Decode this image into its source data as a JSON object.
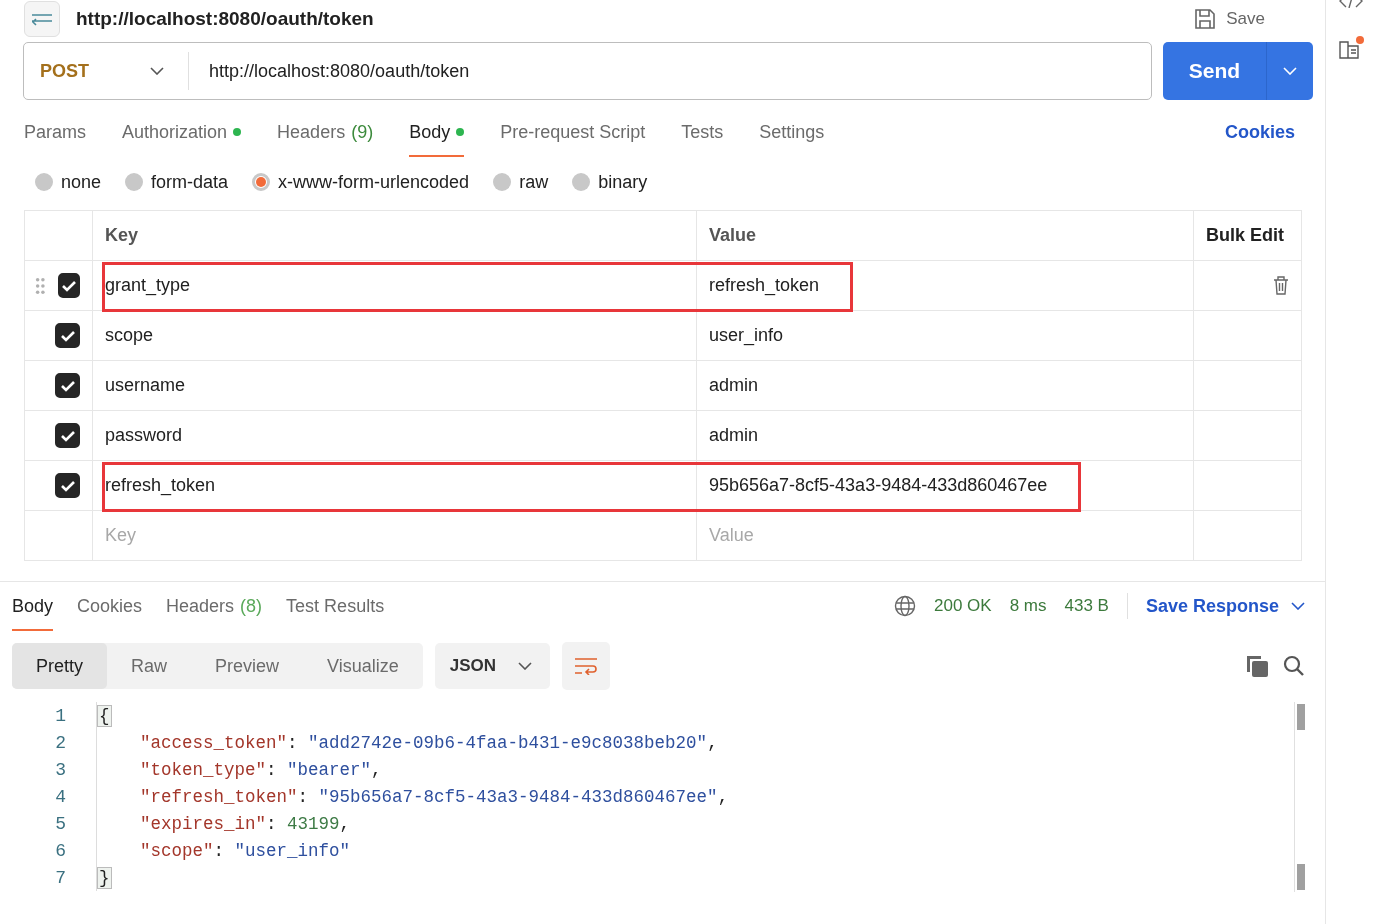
{
  "top": {
    "title": "http://localhost:8080/oauth/token",
    "save": "Save"
  },
  "request": {
    "method": "POST",
    "url": "http://localhost:8080/oauth/token",
    "send": "Send"
  },
  "request_tabs": [
    {
      "label": "Params",
      "selected": false,
      "dot": false
    },
    {
      "label": "Authorization",
      "selected": false,
      "dot": true
    },
    {
      "label": "Headers",
      "count": "(9)",
      "selected": false,
      "dot": false
    },
    {
      "label": "Body",
      "selected": true,
      "dot": true
    },
    {
      "label": "Pre-request Script",
      "selected": false,
      "dot": false
    },
    {
      "label": "Tests",
      "selected": false,
      "dot": false
    },
    {
      "label": "Settings",
      "selected": false,
      "dot": false
    }
  ],
  "cookies_link": "Cookies",
  "body_types": [
    {
      "label": "none",
      "selected": false
    },
    {
      "label": "form-data",
      "selected": false
    },
    {
      "label": "x-www-form-urlencoded",
      "selected": true
    },
    {
      "label": "raw",
      "selected": false
    },
    {
      "label": "binary",
      "selected": false
    }
  ],
  "table": {
    "columns": [
      "Key",
      "Value"
    ],
    "bulk_edit": "Bulk Edit",
    "rows": [
      {
        "key": "grant_type",
        "value": "refresh_token",
        "checked": true,
        "highlighted": true,
        "hovered": true
      },
      {
        "key": "scope",
        "value": "user_info",
        "checked": true,
        "highlighted": false,
        "hovered": false
      },
      {
        "key": "username",
        "value": "admin",
        "checked": true,
        "highlighted": false,
        "hovered": false
      },
      {
        "key": "password",
        "value": "admin",
        "checked": true,
        "highlighted": false,
        "hovered": false
      },
      {
        "key": "refresh_token",
        "value": "95b656a7-8cf5-43a3-9484-433d860467ee",
        "checked": true,
        "highlighted": true,
        "hovered": false
      }
    ],
    "placeholder_key": "Key",
    "placeholder_value": "Value"
  },
  "response": {
    "tabs": [
      {
        "label": "Body",
        "selected": true
      },
      {
        "label": "Cookies",
        "selected": false
      },
      {
        "label": "Headers",
        "count": "(8)",
        "selected": false
      },
      {
        "label": "Test Results",
        "selected": false
      }
    ],
    "status": "200 OK",
    "time": "8 ms",
    "size": "433 B",
    "save_response": "Save Response",
    "views": [
      {
        "label": "Pretty",
        "selected": true
      },
      {
        "label": "Raw",
        "selected": false
      },
      {
        "label": "Preview",
        "selected": false
      },
      {
        "label": "Visualize",
        "selected": false
      }
    ],
    "format": "JSON",
    "lines": [
      {
        "number": "1",
        "indented": false,
        "tokens": [
          {
            "kind": "bracket",
            "text": "{"
          }
        ]
      },
      {
        "number": "2",
        "indented": true,
        "tokens": [
          {
            "kind": "key",
            "text": "\"access_token\""
          },
          {
            "kind": "punct",
            "text": ": "
          },
          {
            "kind": "string",
            "text": "\"add2742e-09b6-4faa-b431-e9c8038beb20\""
          },
          {
            "kind": "punct",
            "text": ","
          }
        ]
      },
      {
        "number": "3",
        "indented": true,
        "tokens": [
          {
            "kind": "key",
            "text": "\"token_type\""
          },
          {
            "kind": "punct",
            "text": ": "
          },
          {
            "kind": "string",
            "text": "\"bearer\""
          },
          {
            "kind": "punct",
            "text": ","
          }
        ]
      },
      {
        "number": "4",
        "indented": true,
        "tokens": [
          {
            "kind": "key",
            "text": "\"refresh_token\""
          },
          {
            "kind": "punct",
            "text": ": "
          },
          {
            "kind": "string",
            "text": "\"95b656a7-8cf5-43a3-9484-433d860467ee\""
          },
          {
            "kind": "punct",
            "text": ","
          }
        ]
      },
      {
        "number": "5",
        "indented": true,
        "tokens": [
          {
            "kind": "key",
            "text": "\"expires_in\""
          },
          {
            "kind": "punct",
            "text": ": "
          },
          {
            "kind": "number",
            "text": "43199"
          },
          {
            "kind": "punct",
            "text": ","
          }
        ]
      },
      {
        "number": "6",
        "indented": true,
        "tokens": [
          {
            "kind": "key",
            "text": "\"scope\""
          },
          {
            "kind": "punct",
            "text": ": "
          },
          {
            "kind": "string",
            "text": "\"user_info\""
          }
        ]
      },
      {
        "number": "7",
        "indented": false,
        "tokens": [
          {
            "kind": "bracket",
            "text": "}"
          }
        ]
      }
    ]
  }
}
